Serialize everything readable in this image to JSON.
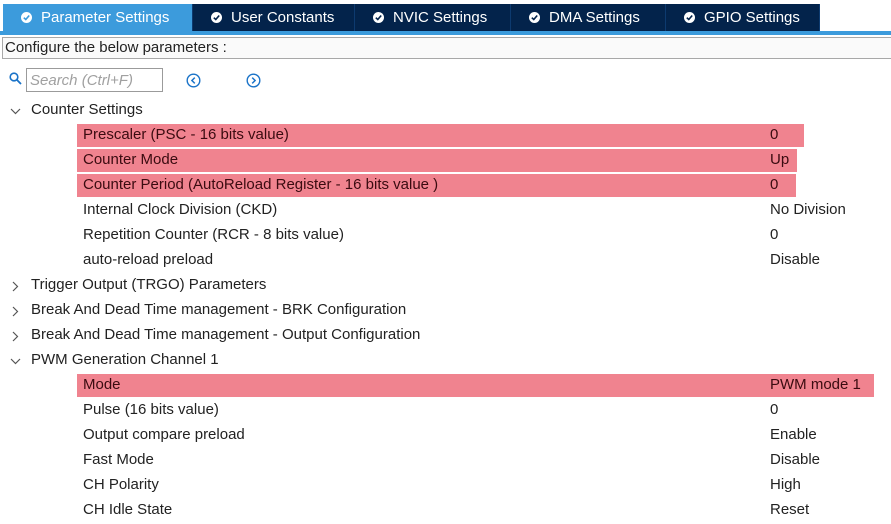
{
  "tabs": [
    {
      "label": "Parameter Settings",
      "active": true
    },
    {
      "label": "User Constants",
      "active": false
    },
    {
      "label": "NVIC Settings",
      "active": false
    },
    {
      "label": "DMA Settings",
      "active": false
    },
    {
      "label": "GPIO Settings",
      "active": false
    }
  ],
  "info": "Configure the below parameters :",
  "search": {
    "placeholder": "Search (Ctrl+F)",
    "value": ""
  },
  "icons": {
    "search": "search-icon",
    "prev": "previous-circle-icon",
    "next": "next-circle-icon",
    "expanded": "chevron-down-icon",
    "collapsed": "chevron-right-icon",
    "tab_check": "check-circle-icon"
  },
  "colors": {
    "tab_bg": "#03234b",
    "tab_active": "#3c9bdc",
    "highlight": "#f0838f",
    "accent": "#3c9bdc"
  },
  "sections": {
    "counter": {
      "label": "Counter Settings",
      "expanded": true,
      "params": [
        {
          "name": "Prescaler (PSC - 16 bits value)",
          "value": "0",
          "highlighted": true
        },
        {
          "name": "Counter Mode",
          "value": "Up",
          "highlighted": true
        },
        {
          "name": "Counter Period (AutoReload Register - 16 bits value )",
          "value": "0",
          "highlighted": true
        },
        {
          "name": "Internal Clock Division (CKD)",
          "value": "No Division",
          "highlighted": false
        },
        {
          "name": "Repetition Counter (RCR - 8 bits value)",
          "value": "0",
          "highlighted": false
        },
        {
          "name": "auto-reload preload",
          "value": "Disable",
          "highlighted": false
        }
      ]
    },
    "trgo": {
      "label": "Trigger Output (TRGO) Parameters",
      "expanded": false
    },
    "brk": {
      "label": "Break And Dead Time management - BRK Configuration",
      "expanded": false
    },
    "output": {
      "label": "Break And Dead Time management - Output Configuration",
      "expanded": false
    },
    "pwm": {
      "label": "PWM Generation Channel 1",
      "expanded": true,
      "params": [
        {
          "name": "Mode",
          "value": "PWM mode 1",
          "highlighted": true
        },
        {
          "name": "Pulse (16 bits value)",
          "value": "0",
          "highlighted": false
        },
        {
          "name": "Output compare preload",
          "value": "Enable",
          "highlighted": false
        },
        {
          "name": "Fast Mode",
          "value": "Disable",
          "highlighted": false
        },
        {
          "name": "CH Polarity",
          "value": "High",
          "highlighted": false
        },
        {
          "name": "CH Idle State",
          "value": "Reset",
          "highlighted": false
        }
      ]
    }
  }
}
